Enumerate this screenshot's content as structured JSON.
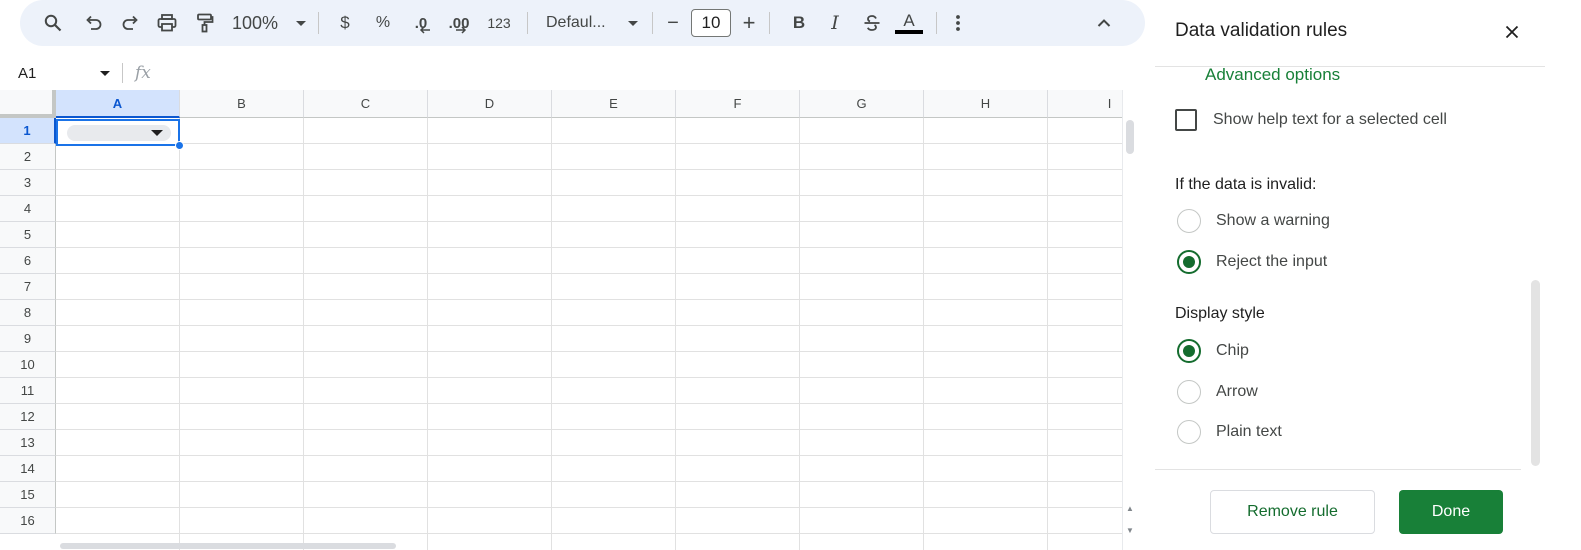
{
  "toolbar": {
    "icons": [
      "search-icon",
      "undo-icon",
      "redo-icon",
      "print-icon",
      "paint-format-icon"
    ],
    "zoom": "100%",
    "currency": "$",
    "percent": "%",
    "decrease_decimal": ".0",
    "increase_decimal": ".00",
    "more_formats": "123",
    "font": "Defaul...",
    "decrease_font": "−",
    "font_size": "10",
    "increase_font": "+",
    "bold": "B",
    "italic": "I",
    "text_color": "A",
    "text_color_swatch": "#000000"
  },
  "formula_bar": {
    "name_box": "A1",
    "fx": "fx"
  },
  "grid": {
    "columns": [
      "A",
      "B",
      "C",
      "D",
      "E",
      "F",
      "G",
      "H",
      "I"
    ],
    "rows": [
      "1",
      "2",
      "3",
      "4",
      "5",
      "6",
      "7",
      "8",
      "9",
      "10",
      "11",
      "12",
      "13",
      "14",
      "15",
      "16"
    ],
    "selected_column": "A",
    "selected_row": "1",
    "selection_color": "#1a73e8"
  },
  "panel": {
    "title": "Data validation rules",
    "advanced_options": "Advanced options",
    "help_text_checkbox": "Show help text for a selected cell",
    "help_text_checked": false,
    "invalid_label": "If the data is invalid:",
    "invalid_options": [
      {
        "label": "Show a warning",
        "selected": false
      },
      {
        "label": "Reject the input",
        "selected": true
      }
    ],
    "display_style_label": "Display style",
    "display_styles": [
      {
        "label": "Chip",
        "selected": true
      },
      {
        "label": "Arrow",
        "selected": false
      },
      {
        "label": "Plain text",
        "selected": false
      }
    ],
    "remove_rule": "Remove rule",
    "done": "Done",
    "accent_color": "#188038"
  }
}
